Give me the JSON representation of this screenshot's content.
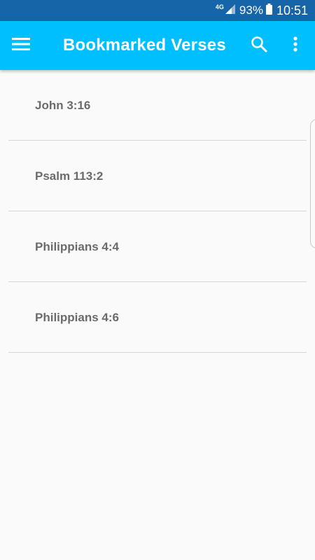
{
  "status_bar": {
    "network": "4G",
    "battery": "93%",
    "time": "10:51"
  },
  "app_bar": {
    "title": "Bookmarked Verses",
    "background": "#00bfff",
    "menu_icon": "hamburger-menu-icon",
    "search_icon": "search-icon",
    "more_icon": "more-vert-icon"
  },
  "bookmarks": [
    {
      "label": "John 3:16"
    },
    {
      "label": "Psalm 113:2"
    },
    {
      "label": "Philippians 4:4"
    },
    {
      "label": "Philippians 4:6"
    }
  ]
}
